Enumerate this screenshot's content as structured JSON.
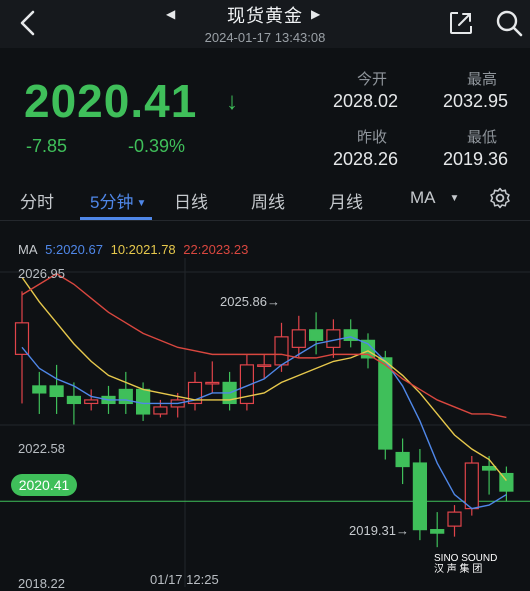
{
  "header": {
    "title": "现货黄金",
    "timestamp": "2024-01-17 13:43:08"
  },
  "quote": {
    "price": "2020.41",
    "change": "-7.85",
    "change_pct": "-0.39%",
    "open_label": "今开",
    "open_value": "2028.02",
    "high_label": "最高",
    "high_value": "2032.95",
    "prev_close_label": "昨收",
    "prev_close_value": "2028.26",
    "low_label": "最低",
    "low_value": "2019.36"
  },
  "tabs": {
    "items": [
      "分时",
      "5分钟",
      "日线",
      "周线",
      "月线",
      "MA"
    ],
    "active": "5分钟"
  },
  "ma_legend": {
    "ma": "MA",
    "ma5": "5:2020.67",
    "ma10": "10:2021.78",
    "ma22": "22:2023.23"
  },
  "colors": {
    "up": "#e0444a",
    "down": "#3fbf5a",
    "ma5": "#4f87e8",
    "ma10": "#e6c84c",
    "ma22": "#d9473f",
    "accent": "#4f87e8"
  },
  "chart_data": {
    "type": "candlestick",
    "axis_labels": {
      "y_top": "2026.95",
      "y_mid": "2022.58",
      "y_bottom": "2018.22",
      "x_time": "01/17 12:25",
      "current": "2020.41"
    },
    "annotations": {
      "high": "2025.86",
      "low": "2019.31"
    },
    "ylim": [
      2018.22,
      2026.95
    ],
    "candles": [
      {
        "o": 2024.6,
        "c": 2025.5,
        "h": 2026.4,
        "l": 2023.2
      },
      {
        "o": 2023.7,
        "c": 2023.5,
        "h": 2024.1,
        "l": 2022.9
      },
      {
        "o": 2023.7,
        "c": 2023.4,
        "h": 2024.3,
        "l": 2022.9
      },
      {
        "o": 2023.4,
        "c": 2023.2,
        "h": 2023.8,
        "l": 2022.6
      },
      {
        "o": 2023.2,
        "c": 2023.3,
        "h": 2023.6,
        "l": 2023.0
      },
      {
        "o": 2023.4,
        "c": 2023.2,
        "h": 2023.7,
        "l": 2022.9
      },
      {
        "o": 2023.6,
        "c": 2023.2,
        "h": 2024.1,
        "l": 2022.9
      },
      {
        "o": 2023.6,
        "c": 2022.9,
        "h": 2023.8,
        "l": 2022.7
      },
      {
        "o": 2022.9,
        "c": 2023.1,
        "h": 2023.3,
        "l": 2022.8
      },
      {
        "o": 2023.1,
        "c": 2023.3,
        "h": 2023.5,
        "l": 2022.8
      },
      {
        "o": 2023.2,
        "c": 2023.8,
        "h": 2024.1,
        "l": 2023.0
      },
      {
        "o": 2023.8,
        "c": 2023.8,
        "h": 2024.4,
        "l": 2023.5
      },
      {
        "o": 2023.8,
        "c": 2023.2,
        "h": 2024.1,
        "l": 2023.0
      },
      {
        "o": 2023.2,
        "c": 2024.3,
        "h": 2024.6,
        "l": 2023.0
      },
      {
        "o": 2024.3,
        "c": 2024.3,
        "h": 2024.6,
        "l": 2023.9
      },
      {
        "o": 2024.3,
        "c": 2025.1,
        "h": 2025.5,
        "l": 2024.1
      },
      {
        "o": 2024.8,
        "c": 2025.3,
        "h": 2025.7,
        "l": 2024.5
      },
      {
        "o": 2025.3,
        "c": 2025.0,
        "h": 2025.8,
        "l": 2024.6
      },
      {
        "o": 2024.8,
        "c": 2025.3,
        "h": 2025.6,
        "l": 2024.5
      },
      {
        "o": 2025.3,
        "c": 2025.0,
        "h": 2025.6,
        "l": 2024.8
      },
      {
        "o": 2025.0,
        "c": 2024.5,
        "h": 2025.2,
        "l": 2024.2
      },
      {
        "o": 2024.5,
        "c": 2021.9,
        "h": 2024.7,
        "l": 2021.6
      },
      {
        "o": 2021.8,
        "c": 2021.4,
        "h": 2022.2,
        "l": 2020.9
      },
      {
        "o": 2021.5,
        "c": 2019.6,
        "h": 2021.9,
        "l": 2019.3
      },
      {
        "o": 2019.6,
        "c": 2019.5,
        "h": 2020.1,
        "l": 2019.1
      },
      {
        "o": 2019.7,
        "c": 2020.1,
        "h": 2020.3,
        "l": 2019.4
      },
      {
        "o": 2020.2,
        "c": 2021.5,
        "h": 2021.7,
        "l": 2020.0
      },
      {
        "o": 2021.4,
        "c": 2021.3,
        "h": 2021.7,
        "l": 2020.6
      },
      {
        "o": 2021.2,
        "c": 2020.7,
        "h": 2021.4,
        "l": 2020.4
      }
    ],
    "series": [
      {
        "name": "MA5",
        "values": [
          2024.8,
          2024.2,
          2023.9,
          2023.7,
          2023.4,
          2023.3,
          2023.3,
          2023.2,
          2023.2,
          2023.2,
          2023.3,
          2023.5,
          2023.5,
          2023.7,
          2023.9,
          2024.3,
          2024.6,
          2024.9,
          2025.0,
          2025.1,
          2024.9,
          2024.4,
          2023.7,
          2022.7,
          2021.5,
          2020.6,
          2020.2,
          2020.3,
          2020.6
        ]
      },
      {
        "name": "MA10",
        "values": [
          2026.8,
          2026.1,
          2025.5,
          2024.9,
          2024.4,
          2024.0,
          2023.8,
          2023.6,
          2023.5,
          2023.4,
          2023.3,
          2023.3,
          2023.3,
          2023.4,
          2023.5,
          2023.8,
          2024.0,
          2024.2,
          2024.4,
          2024.5,
          2024.7,
          2024.4,
          2024.0,
          2023.5,
          2022.9,
          2022.3,
          2021.9,
          2021.6,
          2021.0
        ]
      },
      {
        "name": "MA22",
        "values": [
          2026.3,
          2026.6,
          2026.9,
          2026.6,
          2026.2,
          2025.8,
          2025.5,
          2025.2,
          2025.0,
          2024.8,
          2024.7,
          2024.6,
          2024.6,
          2024.6,
          2024.6,
          2024.6,
          2024.5,
          2024.5,
          2024.6,
          2024.6,
          2024.6,
          2024.3,
          2023.9,
          2023.6,
          2023.3,
          2023.1,
          2022.9,
          2022.9,
          2022.8
        ]
      }
    ]
  },
  "watermark": {
    "line1": "SINO SOUND",
    "line2": "汉 声 集 团"
  }
}
